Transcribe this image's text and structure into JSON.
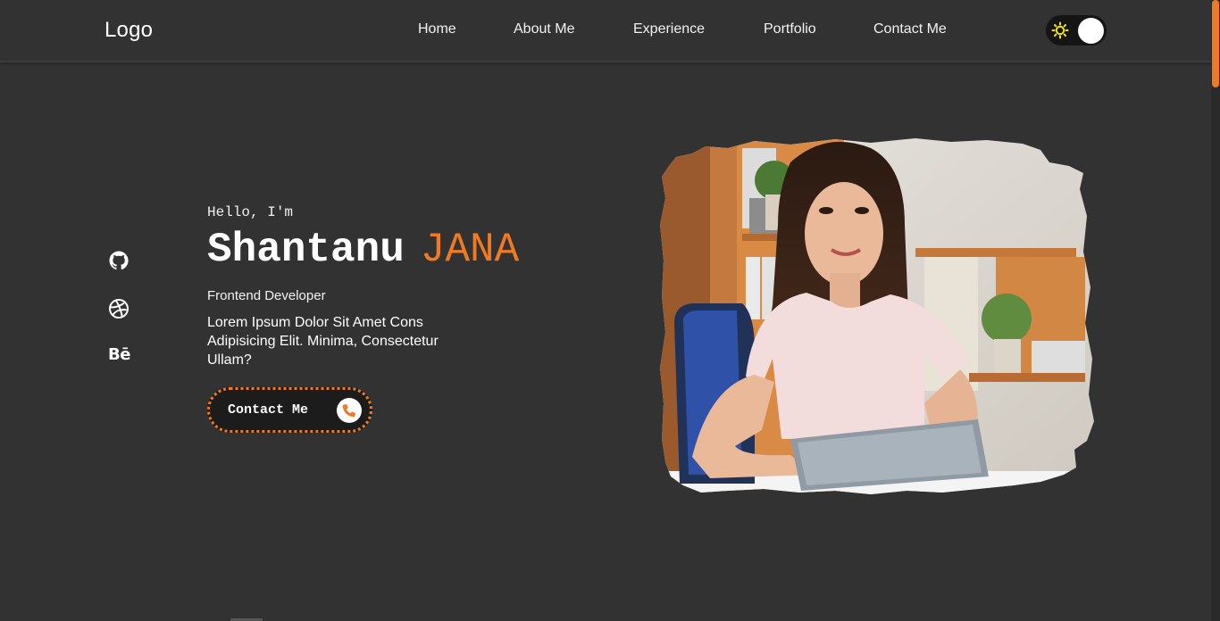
{
  "header": {
    "logo": "Logo",
    "nav": [
      {
        "label": "Home"
      },
      {
        "label": "About Me"
      },
      {
        "label": "Experience"
      },
      {
        "label": "Portfolio"
      },
      {
        "label": "Contact Me"
      }
    ],
    "theme_toggle": {
      "icon": "sun-icon",
      "state": "dark"
    }
  },
  "social": [
    {
      "name": "github-icon"
    },
    {
      "name": "dribbble-icon"
    },
    {
      "name": "behance-icon",
      "text": "Bē"
    }
  ],
  "hero": {
    "greeting": "Hello, I'm",
    "first_name": "Shantanu",
    "last_name": "JANA",
    "role": "Frontend Developer",
    "description": "Lorem Ipsum Dolor Sit Amet Cons Adipisicing Elit. Minima, Consectetur Ullam?",
    "cta_label": "Contact Me",
    "cta_icon": "phone-icon"
  },
  "colors": {
    "accent": "#f07a24",
    "background": "#323232"
  }
}
